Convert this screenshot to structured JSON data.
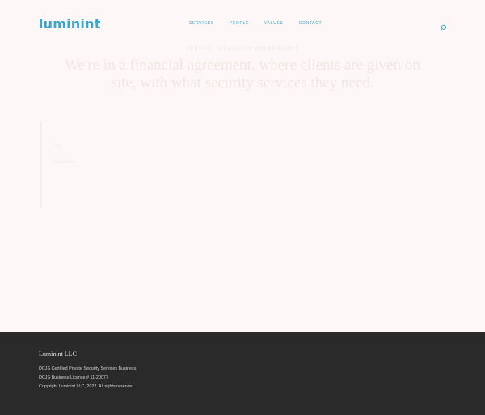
{
  "header": {
    "logo_text": "luminint",
    "nav": [
      "SERVICES",
      "PEOPLE",
      "VALUES",
      "CONTACT"
    ],
    "search_icon": "search-icon"
  },
  "hero": {
    "kicker": "SERVING VIRGINIA'S GOVERNMENT",
    "title": "We're in a financial agreement, where clients are given on site, with what security services they need."
  },
  "card": {
    "label": "Tags",
    "link": "Read more"
  },
  "footer": {
    "title": "Luminint LLC",
    "lines": [
      "DCJS Certified Private Security Services Business",
      "DCJS Business License # 11-20077",
      "Copyright Luminint LLC, 2022.  All rights reserved."
    ]
  },
  "colors": {
    "accent": "#3aa6cf",
    "background": "#fdf8f7",
    "footer_bg": "#2b2a2a"
  }
}
